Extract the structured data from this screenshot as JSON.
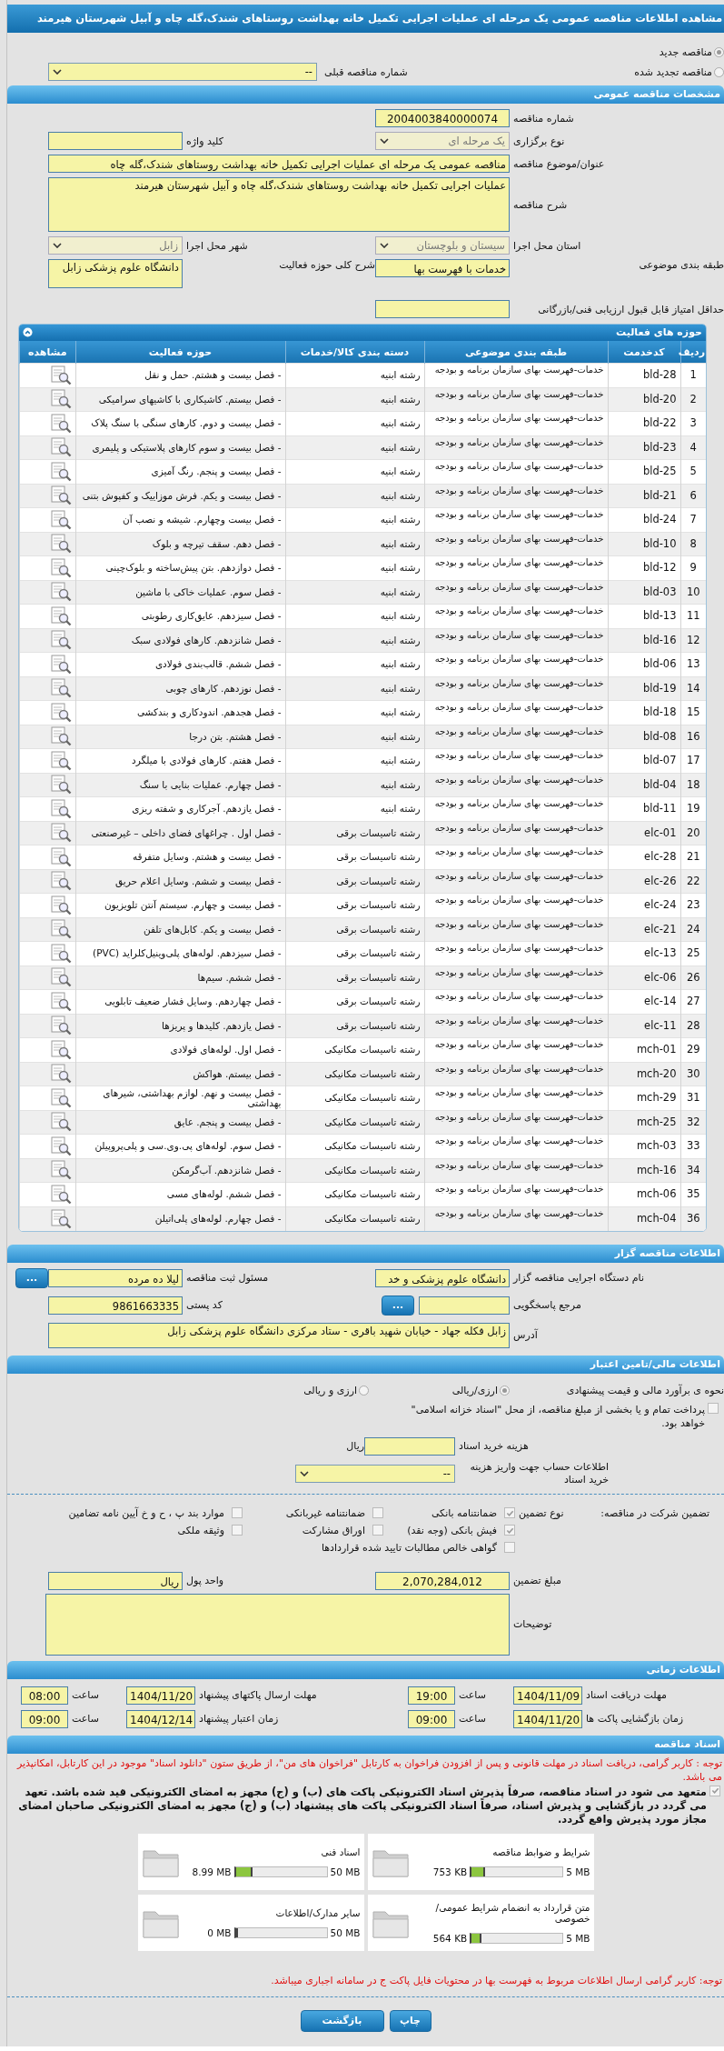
{
  "title": "مشاهده اطلاعات مناقصه عمومی یک مرحله ای عملیات اجرایی تکمیل خانه بهداشت روستاهای شندک،گله چاه و آبیل شهرستان هیرمند",
  "tender_type": [
    {
      "label": "مناقصه جدید",
      "selected": true
    },
    {
      "label": "مناقصه تجدید شده",
      "selected": false
    }
  ],
  "previous_tender": {
    "label": "شماره مناقصه قبلی",
    "value": "--"
  },
  "general": {
    "header": "مشخصات مناقصه عمومی",
    "tender_number": {
      "label": "شماره مناقصه",
      "value": "2004003840000074"
    },
    "holding_type": {
      "label": "نوع برگزاری",
      "value": "یک مرحله ای",
      "disabled": true
    },
    "keyword": {
      "label": "کلید واژه"
    },
    "subject": {
      "label": "عنوان/موضوع مناقصه",
      "value": "مناقصه عمومی یک مرحله ای عملیات اجرایی تکمیل خانه بهداشت روستاهای شندک،گله چاه"
    },
    "description": {
      "label": "شرح مناقصه",
      "value": "عملیات اجرایی تکمیل خانه بهداشت روستاهای شندک،گله چاه و آبیل شهرستان هیرمند"
    },
    "province": {
      "label": "استان محل اجرا",
      "value": "سیستان و بلوچستان",
      "disabled": true
    },
    "city": {
      "label": "شهر محل اجرا",
      "value": "زابل",
      "disabled": true
    },
    "category": {
      "label": "طبقه بندی موضوعی",
      "value": "خدمات با فهرست بها"
    },
    "activity_scope": {
      "label": "شرح کلی حوزه فعالیت",
      "value": "دانشگاه علوم پزشکی زابل"
    },
    "min_score": {
      "label": "حداقل امتیاز قابل قبول ارزیابی فنی/بازرگانی"
    }
  },
  "activities": {
    "header": "حوزه های فعالیت",
    "columns": [
      "ردیف",
      "کدخدمت",
      "طبقه بندی موضوعی",
      "دسته بندی کالا/خدمات",
      "حوزه فعالیت",
      "مشاهده"
    ],
    "rows": [
      {
        "index": "1",
        "code": "bld-28",
        "category": "خدمات-فهرست بهای سازمان برنامه و بودجه",
        "group": "رشته ابنیه",
        "activity": "- فصل بیست و هشتم. حمل و نقل"
      },
      {
        "index": "2",
        "code": "bld-20",
        "category": "خدمات-فهرست بهای سازمان برنامه و بودجه",
        "group": "رشته ابنیه",
        "activity": "- فصل بیستم. کاشیکاری با کاشیهای سرامیکی"
      },
      {
        "index": "3",
        "code": "bld-22",
        "category": "خدمات-فهرست بهای سازمان برنامه و بودجه",
        "group": "رشته ابنیه",
        "activity": "- فصل بیست و دوم. کارهای سنگی با سنگ پلاک"
      },
      {
        "index": "4",
        "code": "bld-23",
        "category": "خدمات-فهرست بهای سازمان برنامه و بودجه",
        "group": "رشته ابنیه",
        "activity": "- فصل بیست و سوم کارهای پلاستیکی و پلیمری"
      },
      {
        "index": "5",
        "code": "bld-25",
        "category": "خدمات-فهرست بهای سازمان برنامه و بودجه",
        "group": "رشته ابنیه",
        "activity": "- فصل بیست و پنجم. رنگ آمیزی"
      },
      {
        "index": "6",
        "code": "bld-21",
        "category": "خدمات-فهرست بهای سازمان برنامه و بودجه",
        "group": "رشته ابنیه",
        "activity": "- فصل بیست و یکم. فرش موزاییک و کفپوش بتنی"
      },
      {
        "index": "7",
        "code": "bld-24",
        "category": "خدمات-فهرست بهای سازمان برنامه و بودجه",
        "group": "رشته ابنیه",
        "activity": "- فصل بیست وچهارم. شیشه و نصب آن"
      },
      {
        "index": "8",
        "code": "bld-10",
        "category": "خدمات-فهرست بهای سازمان برنامه و بودجه",
        "group": "رشته ابنیه",
        "activity": "- فصل دهم. سقف تیرچه و بلوک"
      },
      {
        "index": "9",
        "code": "bld-12",
        "category": "خدمات-فهرست بهای سازمان برنامه و بودجه",
        "group": "رشته ابنیه",
        "activity": "- فصل دوازدهم. بتن پیش‌ساخته و بلوک‌چینی"
      },
      {
        "index": "10",
        "code": "bld-03",
        "category": "خدمات-فهرست بهای سازمان برنامه و بودجه",
        "group": "رشته ابنیه",
        "activity": "- فصل سوم. عملیات خاکی با ماشین"
      },
      {
        "index": "11",
        "code": "bld-13",
        "category": "خدمات-فهرست بهای سازمان برنامه و بودجه",
        "group": "رشته ابنیه",
        "activity": "- فصل سیزدهم. عایق‌کاری رطوبتی"
      },
      {
        "index": "12",
        "code": "bld-16",
        "category": "خدمات-فهرست بهای سازمان برنامه و بودجه",
        "group": "رشته ابنیه",
        "activity": "- فصل شانزدهم. کارهای فولادی سبک"
      },
      {
        "index": "13",
        "code": "bld-06",
        "category": "خدمات-فهرست بهای سازمان برنامه و بودجه",
        "group": "رشته ابنیه",
        "activity": "- فصل ششم. قالب‌بندی فولادی"
      },
      {
        "index": "14",
        "code": "bld-19",
        "category": "خدمات-فهرست بهای سازمان برنامه و بودجه",
        "group": "رشته ابنیه",
        "activity": "- فصل نوزدهم. کارهای چوبی"
      },
      {
        "index": "15",
        "code": "bld-18",
        "category": "خدمات-فهرست بهای سازمان برنامه و بودجه",
        "group": "رشته ابنیه",
        "activity": "- فصل هجدهم. اندودکاری و بندکشی"
      },
      {
        "index": "16",
        "code": "bld-08",
        "category": "خدمات-فهرست بهای سازمان برنامه و بودجه",
        "group": "رشته ابنیه",
        "activity": "- فصل هشتم. بتن درجا"
      },
      {
        "index": "17",
        "code": "bld-07",
        "category": "خدمات-فهرست بهای سازمان برنامه و بودجه",
        "group": "رشته ابنیه",
        "activity": "- فصل هفتم. کارهای فولادی با میلگرد"
      },
      {
        "index": "18",
        "code": "bld-04",
        "category": "خدمات-فهرست بهای سازمان برنامه و بودجه",
        "group": "رشته ابنیه",
        "activity": "- فصل چهارم. عملیات بنایی با سنگ"
      },
      {
        "index": "19",
        "code": "bld-11",
        "category": "خدمات-فهرست بهای سازمان برنامه و بودجه",
        "group": "رشته ابنیه",
        "activity": "- فصل یازدهم. آجرکاری و شفته ریزی"
      },
      {
        "index": "20",
        "code": "elc-01",
        "category": "خدمات-فهرست بهای سازمان برنامه و بودجه",
        "group": "رشته تاسیسات برقی",
        "activity": "- فصل اول . چراغهای فضای داخلی – غیرصنعتی"
      },
      {
        "index": "21",
        "code": "elc-28",
        "category": "خدمات-فهرست بهای سازمان برنامه و بودجه",
        "group": "رشته تاسیسات برقی",
        "activity": "- فصل بیست و هشتم. وسایل متفرقه"
      },
      {
        "index": "22",
        "code": "elc-26",
        "category": "خدمات-فهرست بهای سازمان برنامه و بودجه",
        "group": "رشته تاسیسات برقی",
        "activity": "- فصل بیست و ششم. وسایل اعلام حریق"
      },
      {
        "index": "23",
        "code": "elc-24",
        "category": "خدمات-فهرست بهای سازمان برنامه و بودجه",
        "group": "رشته تاسیسات برقی",
        "activity": "- فصل بیست و چهارم. سیستم آنتن تلویزیون"
      },
      {
        "index": "24",
        "code": "elc-21",
        "category": "خدمات-فهرست بهای سازمان برنامه و بودجه",
        "group": "رشته تاسیسات برقی",
        "activity": "- فصل بیست و یکم. کابل‌های تلفن"
      },
      {
        "index": "25",
        "code": "elc-13",
        "category": "خدمات-فهرست بهای سازمان برنامه و بودجه",
        "group": "رشته تاسیسات برقی",
        "activity": "- فصل سیزدهم. لوله‌های پلی‌وینیل‌کلراید (PVC)"
      },
      {
        "index": "26",
        "code": "elc-06",
        "category": "خدمات-فهرست بهای سازمان برنامه و بودجه",
        "group": "رشته تاسیسات برقی",
        "activity": "- فصل ششم. سیم‌ها"
      },
      {
        "index": "27",
        "code": "elc-14",
        "category": "خدمات-فهرست بهای سازمان برنامه و بودجه",
        "group": "رشته تاسیسات برقی",
        "activity": "- فصل چهاردهم. وسایل فشار ضعیف تابلویی"
      },
      {
        "index": "28",
        "code": "elc-11",
        "category": "خدمات-فهرست بهای سازمان برنامه و بودجه",
        "group": "رشته تاسیسات برقی",
        "activity": "- فصل یازدهم. کلیدها و پریزها"
      },
      {
        "index": "29",
        "code": "mch-01",
        "category": "خدمات-فهرست بهای سازمان برنامه و بودجه",
        "group": "رشته تاسیسات مکانیکی",
        "activity": "- فصل اول. لوله‌های فولادی"
      },
      {
        "index": "30",
        "code": "mch-20",
        "category": "خدمات-فهرست بهای سازمان برنامه و بودجه",
        "group": "رشته تاسیسات مکانیکی",
        "activity": "- فصل بیستم. هواکش"
      },
      {
        "index": "31",
        "code": "mch-29",
        "category": "خدمات-فهرست بهای سازمان برنامه و بودجه",
        "group": "رشته تاسیسات مکانیکی",
        "activity": "- فصل بیست و نهم. لوازم بهداشتی، شیرهای بهداشتی"
      },
      {
        "index": "32",
        "code": "mch-25",
        "category": "خدمات-فهرست بهای سازمان برنامه و بودجه",
        "group": "رشته تاسیسات مکانیکی",
        "activity": "- فصل بیست و پنجم. عایق"
      },
      {
        "index": "33",
        "code": "mch-03",
        "category": "خدمات-فهرست بهای سازمان برنامه و بودجه",
        "group": "رشته تاسیسات مکانیکی",
        "activity": "- فصل سوم. لوله‌های پی.وی.سی و پلی‌پروپیلن"
      },
      {
        "index": "34",
        "code": "mch-16",
        "category": "خدمات-فهرست بهای سازمان برنامه و بودجه",
        "group": "رشته تاسیسات مکانیکی",
        "activity": "- فصل شانزدهم. آب‌گرمکن"
      },
      {
        "index": "35",
        "code": "mch-06",
        "category": "خدمات-فهرست بهای سازمان برنامه و بودجه",
        "group": "رشته تاسیسات مکانیکی",
        "activity": "- فصل ششم. لوله‌های مسی"
      },
      {
        "index": "36",
        "code": "mch-04",
        "category": "خدمات-فهرست بهای سازمان برنامه و بودجه",
        "group": "رشته تاسیسات مکانیکی",
        "activity": "- فصل چهارم. لوله‌های پلی‌اتیلن"
      }
    ]
  },
  "tenderer": {
    "header": "اطلاعات مناقصه گزار",
    "organization": {
      "label": "نام دستگاه اجرایی مناقصه گزار",
      "value": "دانشگاه علوم پزشکی و خد"
    },
    "registrar": {
      "label": "مسئول ثبت مناقصه",
      "value": "لیلا ده مرده",
      "button": "..."
    },
    "contact": {
      "label": "مرجع پاسخگویی",
      "button": "..."
    },
    "postal_code": {
      "label": "کد پستی",
      "value": "9861663335"
    },
    "address": {
      "label": "آدرس",
      "value": "زابل فکله جهاد - خیابان شهید باقری - ستاد مرکزی دانشگاه علوم پزشکی زابل"
    }
  },
  "finance": {
    "header": "اطلاعات مالی/تامین اعتبار",
    "estimate_label": "نحوه ی برآورد مالی و قیمت پیشنهادی",
    "estimate_options": [
      {
        "label": "ارزی/ریالی",
        "selected": true
      },
      {
        "label": "ارزی و ریالی",
        "selected": false
      }
    ],
    "treasury": {
      "label": "پرداخت تمام و یا بخشی از مبلغ مناقصه، از محل \"اسناد خزانه اسلامی\" خواهد بود.",
      "checked": false
    },
    "document_fee": {
      "label": "هزینه خرید اسناد",
      "unit": "ریال"
    },
    "account": {
      "label": "اطلاعات حساب جهت واریز هزینه خرید اسناد",
      "value": "--"
    },
    "guarantee_label": "تضمین شرکت در مناقصه:",
    "guarantee_type_label": "نوع تضمین",
    "guarantee_types": [
      {
        "label": "ضمانتنامه بانکی",
        "checked": true
      },
      {
        "label": "ضمانتنامه غیربانکی",
        "checked": false
      },
      {
        "label": "موارد بند پ ، ح و خ آیین نامه تضامین",
        "checked": false
      },
      {
        "label": "فیش بانکی (وجه نقد)",
        "checked": true
      },
      {
        "label": "اوراق مشارکت",
        "checked": false
      },
      {
        "label": "وثیقه ملکی",
        "checked": false
      },
      {
        "label": "گواهی خالص مطالبات تایید شده قراردادها",
        "checked": false
      }
    ],
    "guarantee_amount": {
      "label": "مبلغ تضمین",
      "value": "2,070,284,012"
    },
    "currency": {
      "label": "واحد پول",
      "value": "ریال"
    },
    "notes": {
      "label": "توضیحات"
    }
  },
  "timing": {
    "header": "اطلاعات زمانی",
    "items": [
      {
        "label": "مهلت دریافت اسناد",
        "date": "1404/11/09",
        "time_label": "ساعت",
        "time": "19:00"
      },
      {
        "label": "مهلت ارسال پاکتهای پیشنهاد",
        "date": "1404/11/20",
        "time_label": "ساعت",
        "time": "08:00"
      },
      {
        "label": "زمان بازگشایی پاکت ها",
        "date": "1404/11/20",
        "time_label": "ساعت",
        "time": "09:00"
      },
      {
        "label": "زمان اعتبار پیشنهاد",
        "date": "1404/12/14",
        "time_label": "ساعت",
        "time": "09:00"
      }
    ]
  },
  "documents": {
    "header": "اسناد مناقصه",
    "notice": "توجه : کاربر گرامی، دریافت اسناد در مهلت قانونی و پس از افزودن فراخوان به کارتابل \"فراخوان های من\"، از طریق ستون \"دانلود اسناد\" موجود در این کارتابل، امکانپذیر می باشد.",
    "commitment": {
      "label": "متعهد می شود در اسناد مناقصه، صرفاً پذیرش اسناد الکترونیکی پاکت های (ب) و (ج) مجهز به امضای الکترونیکی قید شده باشد. تعهد می گردد در بازگشایی و پذیرش اسناد، صرفاً اسناد الکترونیکی پاکت های پیشنهاد (ب) و (ج) مجهز به امضای الکترونیکی صاحبان امضای مجاز مورد پذیرش واقع گردد.",
      "checked": true
    },
    "files": [
      {
        "title": "شرایط و ضوابط مناقصه",
        "used": "753 KB",
        "max": "5 MB",
        "level": 0.15
      },
      {
        "title": "اسناد فنی",
        "used": "8.99 MB",
        "max": "50 MB",
        "level": 0.18
      },
      {
        "title": "متن قرارداد به انضمام شرایط عمومی/خصوصی",
        "used": "564 KB",
        "max": "5 MB",
        "level": 0.11
      },
      {
        "title": "سایر مدارک/اطلاعات",
        "used": "0 MB",
        "max": "50 MB",
        "level": 0
      }
    ],
    "footer_notice": "توجه: کاربر گرامی ارسال اطلاعات مربوط به فهرست بها در محتویات فایل پاکت ج در سامانه اجباری میباشد."
  },
  "buttons": [
    "چاپ",
    "بازگشت"
  ]
}
